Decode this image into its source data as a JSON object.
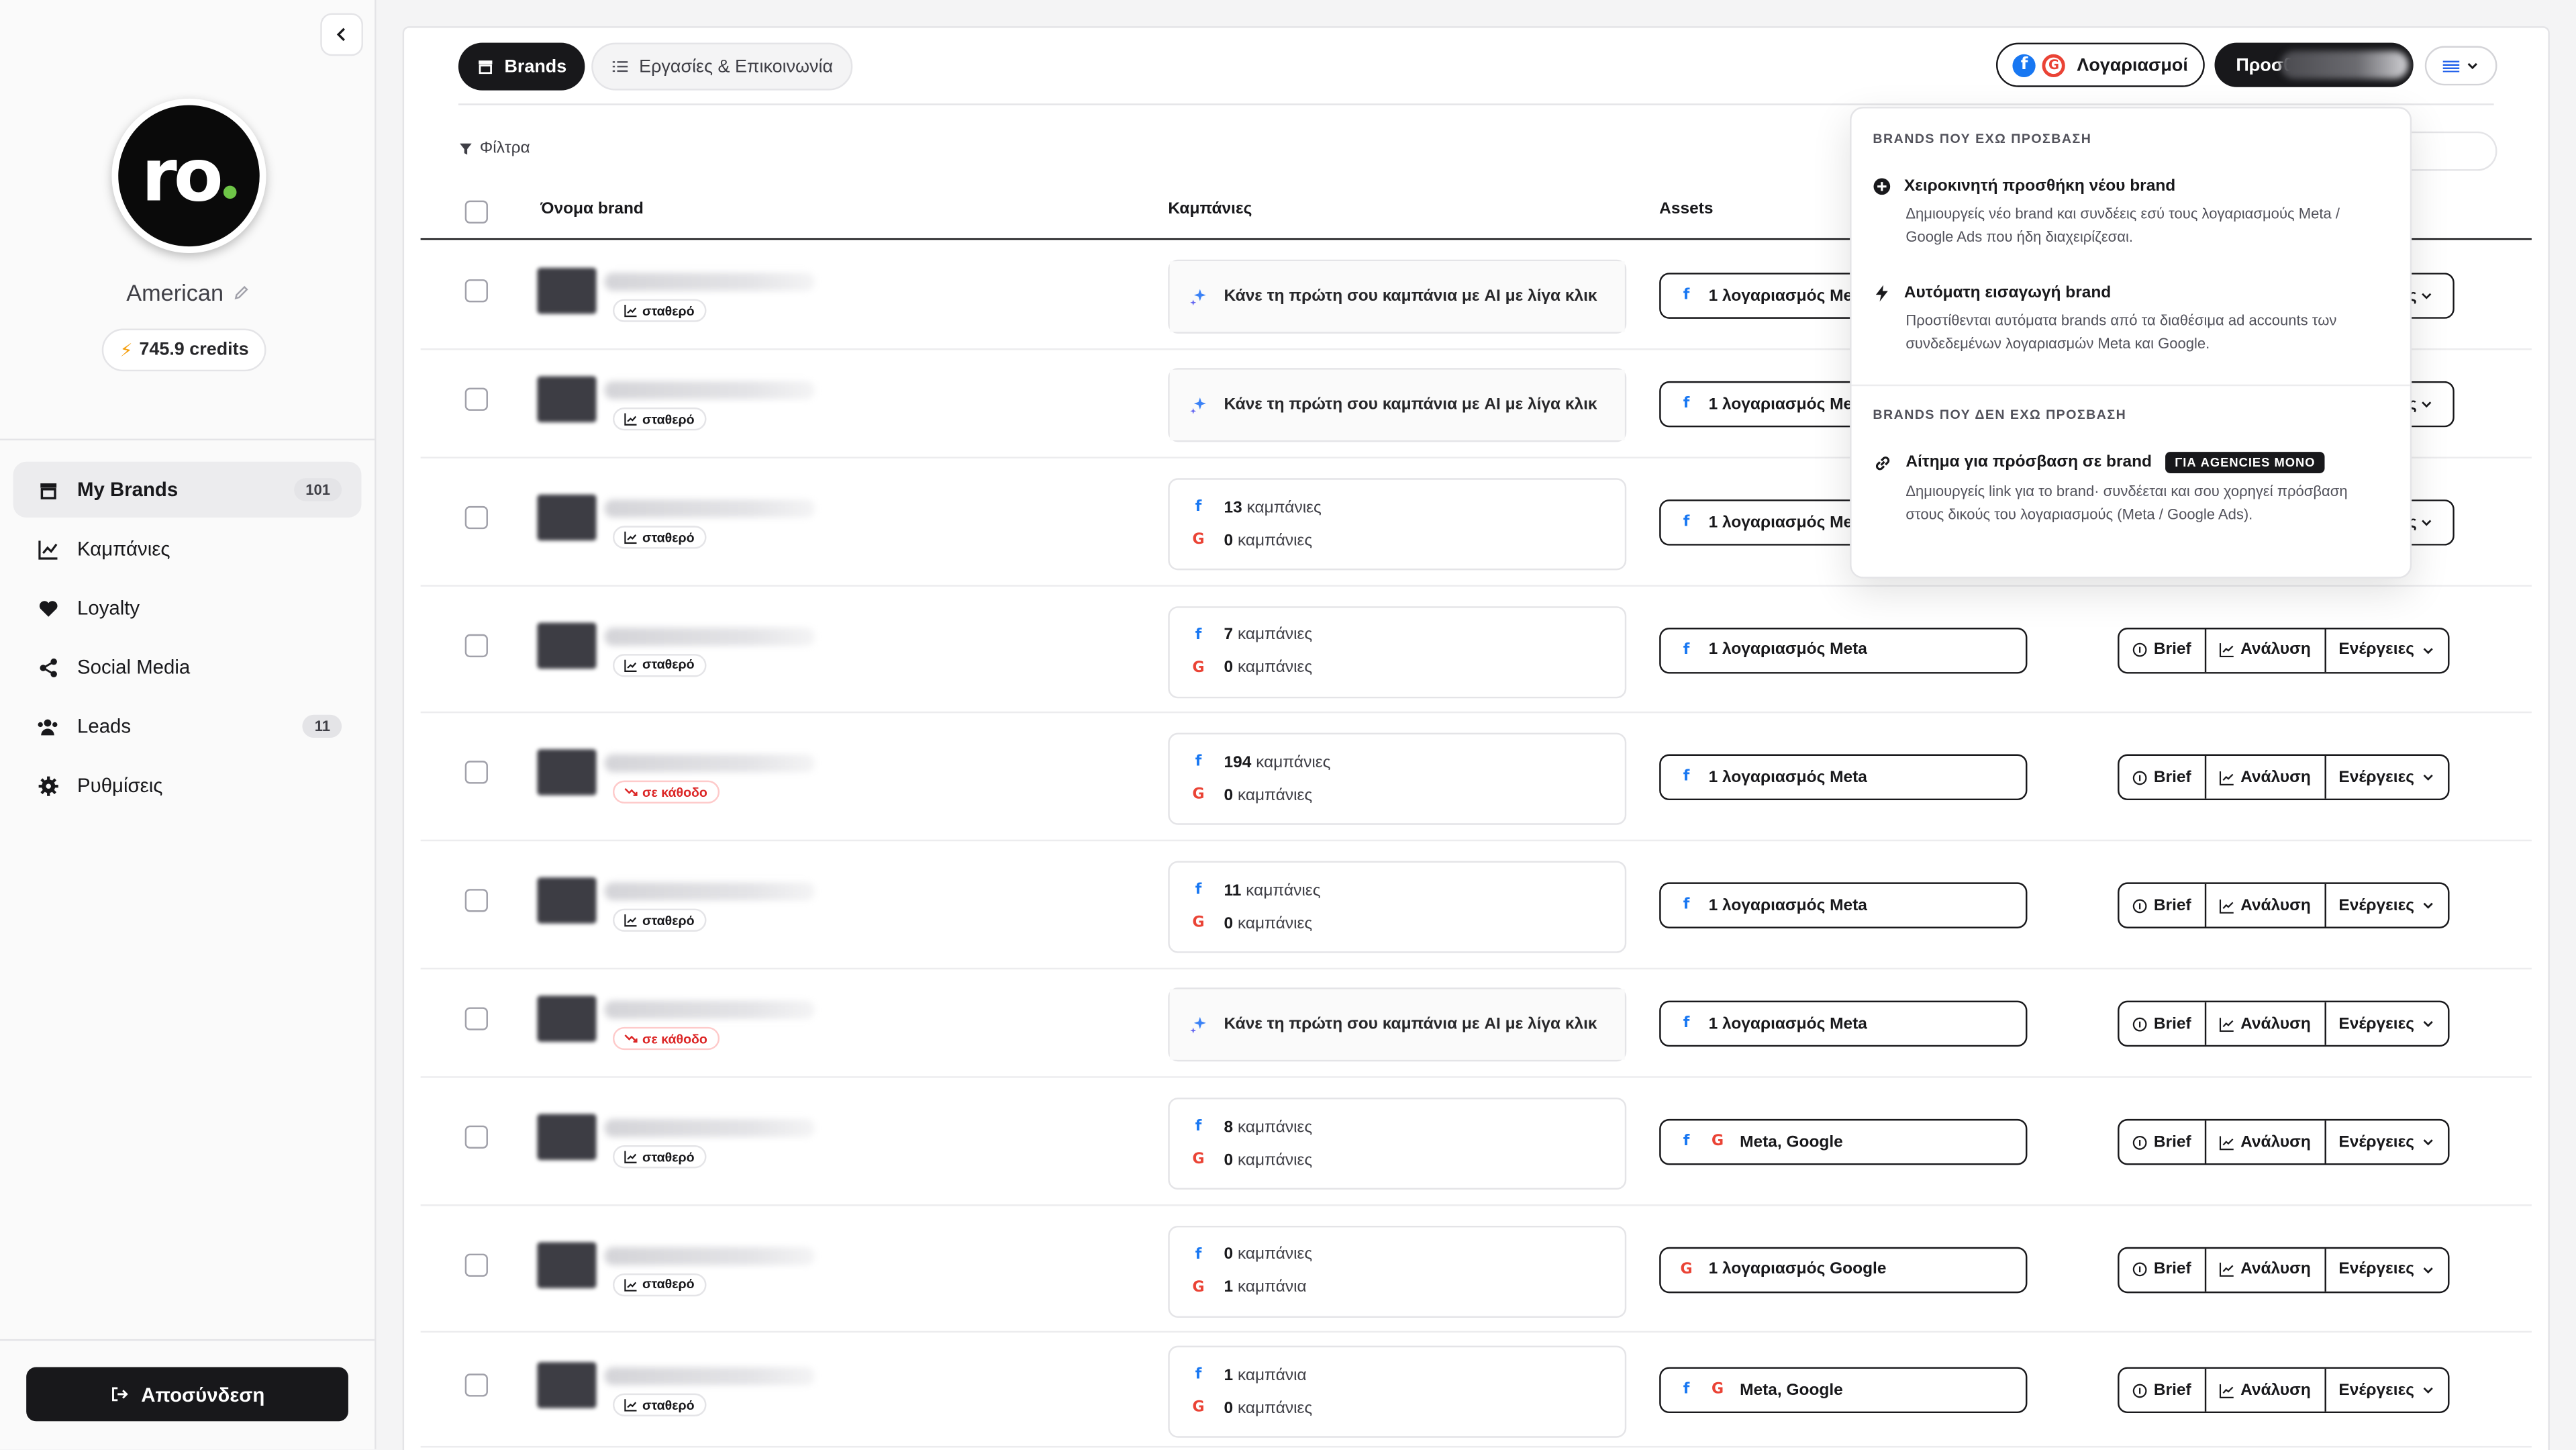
{
  "sidebar": {
    "avatar_text": "ro",
    "account_name": "American",
    "credits": "745.9 credits",
    "nav": [
      {
        "label": "My Brands",
        "badge": "101",
        "icon": "store-icon",
        "active": true
      },
      {
        "label": "Καμπάνιες",
        "badge": "",
        "icon": "chart-line-icon",
        "active": false
      },
      {
        "label": "Loyalty",
        "badge": "",
        "icon": "heart-icon",
        "active": false
      },
      {
        "label": "Social Media",
        "badge": "",
        "icon": "share-icon",
        "active": false
      },
      {
        "label": "Leads",
        "badge": "11",
        "icon": "users-icon",
        "active": false
      },
      {
        "label": "Ρυθμίσεις",
        "badge": "",
        "icon": "gear-icon",
        "active": false
      }
    ],
    "logout_label": "Αποσύνδεση"
  },
  "header": {
    "tab_brands": "Brands",
    "tab_tasks": "Εργασίες & Επικοινωνία",
    "accounts_label": "Λογαριασμοί",
    "add_label": "Προσθ"
  },
  "filters_label": "Φίλτρα",
  "table": {
    "columns": {
      "name": "Όνομα brand",
      "campaigns": "Καμπάνιες",
      "assets": "Assets"
    },
    "ai_prompt": "Κάνε τη πρώτη σου καμπάνια με AI με λίγα κλικ",
    "actions": {
      "brief": "Brief",
      "analysis": "Ανάλυση",
      "more": "Ενέργειες",
      "more_cut": "ς"
    },
    "rows": [
      {
        "trend": "σταθερό",
        "trend_dir": "flat",
        "campaigns": null,
        "assets": "1 λογαριασμός Meta",
        "assets_icons": [
          "fb"
        ],
        "covered": true
      },
      {
        "trend": "σταθερό",
        "trend_dir": "flat",
        "campaigns": null,
        "assets": "1 λογαριασμός Meta",
        "assets_icons": [
          "fb"
        ],
        "covered": true
      },
      {
        "trend": "σταθερό",
        "trend_dir": "flat",
        "campaigns": {
          "meta": "13",
          "meta_unit": "καμπάνιες",
          "google": "0",
          "google_unit": "καμπάνιες"
        },
        "assets": "1 λογαριασμός Meta",
        "assets_icons": [
          "fb"
        ],
        "covered": true
      },
      {
        "trend": "σταθερό",
        "trend_dir": "flat",
        "campaigns": {
          "meta": "7",
          "meta_unit": "καμπάνιες",
          "google": "0",
          "google_unit": "καμπάνιες"
        },
        "assets": "1 λογαριασμός Meta",
        "assets_icons": [
          "fb"
        ],
        "covered": false
      },
      {
        "trend": "σε κάθοδο",
        "trend_dir": "down",
        "campaigns": {
          "meta": "194",
          "meta_unit": "καμπάνιες",
          "google": "0",
          "google_unit": "καμπάνιες"
        },
        "assets": "1 λογαριασμός Meta",
        "assets_icons": [
          "fb"
        ],
        "covered": false
      },
      {
        "trend": "σταθερό",
        "trend_dir": "flat",
        "campaigns": {
          "meta": "11",
          "meta_unit": "καμπάνιες",
          "google": "0",
          "google_unit": "καμπάνιες"
        },
        "assets": "1 λογαριασμός Meta",
        "assets_icons": [
          "fb"
        ],
        "covered": false
      },
      {
        "trend": "σε κάθοδο",
        "trend_dir": "down",
        "campaigns": null,
        "assets": "1 λογαριασμός Meta",
        "assets_icons": [
          "fb"
        ],
        "covered": false
      },
      {
        "trend": "σταθερό",
        "trend_dir": "flat",
        "campaigns": {
          "meta": "8",
          "meta_unit": "καμπάνιες",
          "google": "0",
          "google_unit": "καμπάνιες"
        },
        "assets": "Meta, Google",
        "assets_icons": [
          "fb",
          "g"
        ],
        "covered": false
      },
      {
        "trend": "σταθερό",
        "trend_dir": "flat",
        "campaigns": {
          "meta": "0",
          "meta_unit": "καμπάνιες",
          "google": "1",
          "google_unit": "καμπάνια"
        },
        "assets": "1 λογαριασμός Google",
        "assets_icons": [
          "g"
        ],
        "covered": false
      },
      {
        "trend": "σταθερό",
        "trend_dir": "flat",
        "campaigns": {
          "meta": "1",
          "meta_unit": "καμπάνια",
          "google": "0",
          "google_unit": "καμπάνιες"
        },
        "assets": "Meta, Google",
        "assets_icons": [
          "fb",
          "g"
        ],
        "covered": false
      }
    ]
  },
  "dropdown": {
    "section_access": "BRANDS ΠΟΥ ΕΧΩ ΠΡΟΣΒΑΣΗ",
    "manual_title": "Χειροκινητή προσθήκη νέου brand",
    "manual_desc": "Δημιουργείς νέο brand και συνδέεις εσύ τους λογαριασμούς Meta / Google Ads που ήδη διαχειρίζεσαι.",
    "auto_title": "Αυτόματη εισαγωγή brand",
    "auto_desc": "Προστίθενται αυτόματα brands από τα διαθέσιμα ad accounts των συνδεδεμένων λογαριασμών Meta και Google.",
    "section_no_access": "BRANDS ΠΟΥ ΔΕΝ ΕΧΩ ΠΡΟΣΒΑΣΗ",
    "request_title": "Αίτημα για πρόσβαση σε brand",
    "request_badge": "ΓΙΑ AGENCIES ΜΟΝΟ",
    "request_desc": "Δημιουργείς link για το brand· συνδέεται και σου χορηγεί πρόσβαση στους δικούς του λογαριασμούς (Meta / Google Ads)."
  }
}
